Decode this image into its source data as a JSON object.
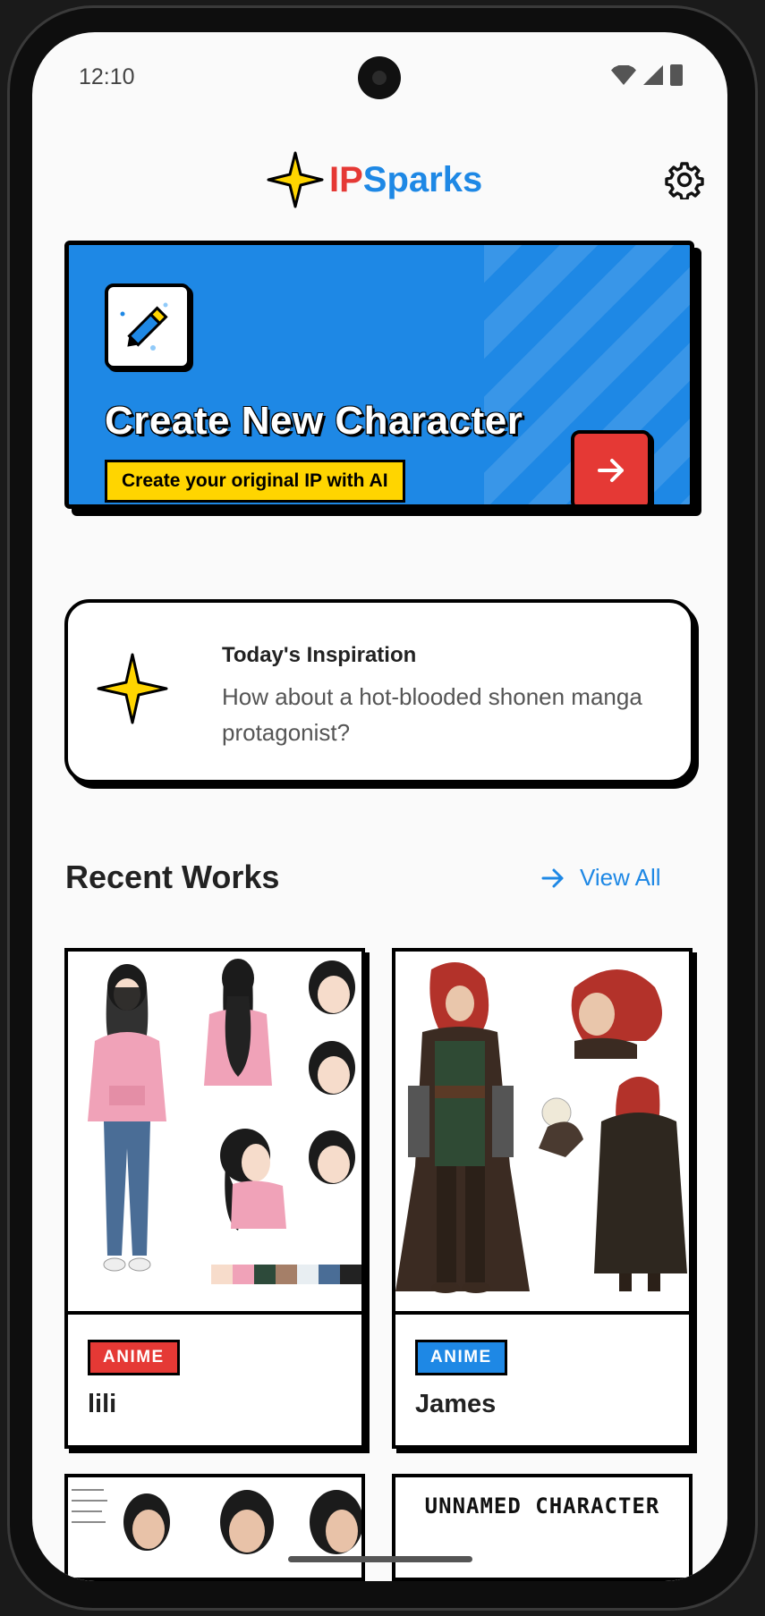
{
  "status": {
    "time": "12:10"
  },
  "header": {
    "brand_ip": "IP",
    "brand_rest": "Sparks"
  },
  "create": {
    "title": "Create New Character",
    "subtitle": "Create your original IP with AI"
  },
  "inspiration": {
    "title": "Today's Inspiration",
    "text": "How about a hot-blooded shonen manga protagonist?"
  },
  "recent": {
    "title": "Recent Works",
    "view_all": "View All",
    "works": [
      {
        "tag": "ANIME",
        "tag_color": "#e53935",
        "name": "lili"
      },
      {
        "tag": "ANIME",
        "tag_color": "#1e88e5",
        "name": "James"
      }
    ],
    "peek": {
      "second_label": "UNNAMED CHARACTER"
    }
  },
  "colors": {
    "blue": "#1e88e5",
    "red": "#e53935",
    "yellow": "#ffd500"
  }
}
